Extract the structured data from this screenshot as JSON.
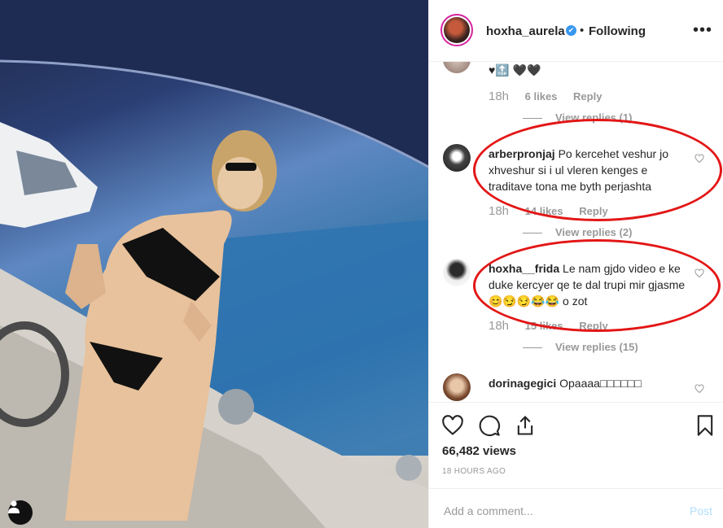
{
  "post": {
    "username": "hoxha_aurela",
    "verified_mark": "✔",
    "separator": "•",
    "follow_state": "Following",
    "more_label": "•••"
  },
  "comments": [
    {
      "user": "",
      "text": "♥🔝 🖤🖤",
      "time": "18h",
      "likes": "6 likes",
      "reply": "Reply",
      "view_replies": "View replies (1)"
    },
    {
      "user": "arberpronjaj",
      "text": "Po kercehet veshur jo xhveshur si i ul vleren kenges e traditave tona me byth perjashta",
      "time": "18h",
      "likes": "14 likes",
      "reply": "Reply",
      "view_replies": "View replies (2)"
    },
    {
      "user": "hoxha__frida",
      "text": "Le nam gjdo video e ke duke kercyer qe te dal trupi mir gjasme 😊😏😏😂😂 o zot",
      "time": "18h",
      "likes": "15 likes",
      "reply": "Reply",
      "view_replies": "View replies (15)"
    },
    {
      "user": "dorinagegici",
      "text": "Opaaaa□□□□□□",
      "time": "",
      "likes": "",
      "reply": "",
      "view_replies": ""
    }
  ],
  "actions": {
    "views": "66,482 views",
    "time_ago": "18 HOURS AGO"
  },
  "add_comment": {
    "placeholder": "Add a comment...",
    "post_label": "Post"
  },
  "colors": {
    "verified_blue": "#3897f0",
    "annotation_red": "#e31616",
    "post_disabled": "#b2dffc"
  },
  "icons": [
    "heart-icon",
    "comment-icon",
    "share-icon",
    "bookmark-icon",
    "more-icon",
    "verified-icon",
    "user-tag-icon",
    "like-comment-icon"
  ]
}
